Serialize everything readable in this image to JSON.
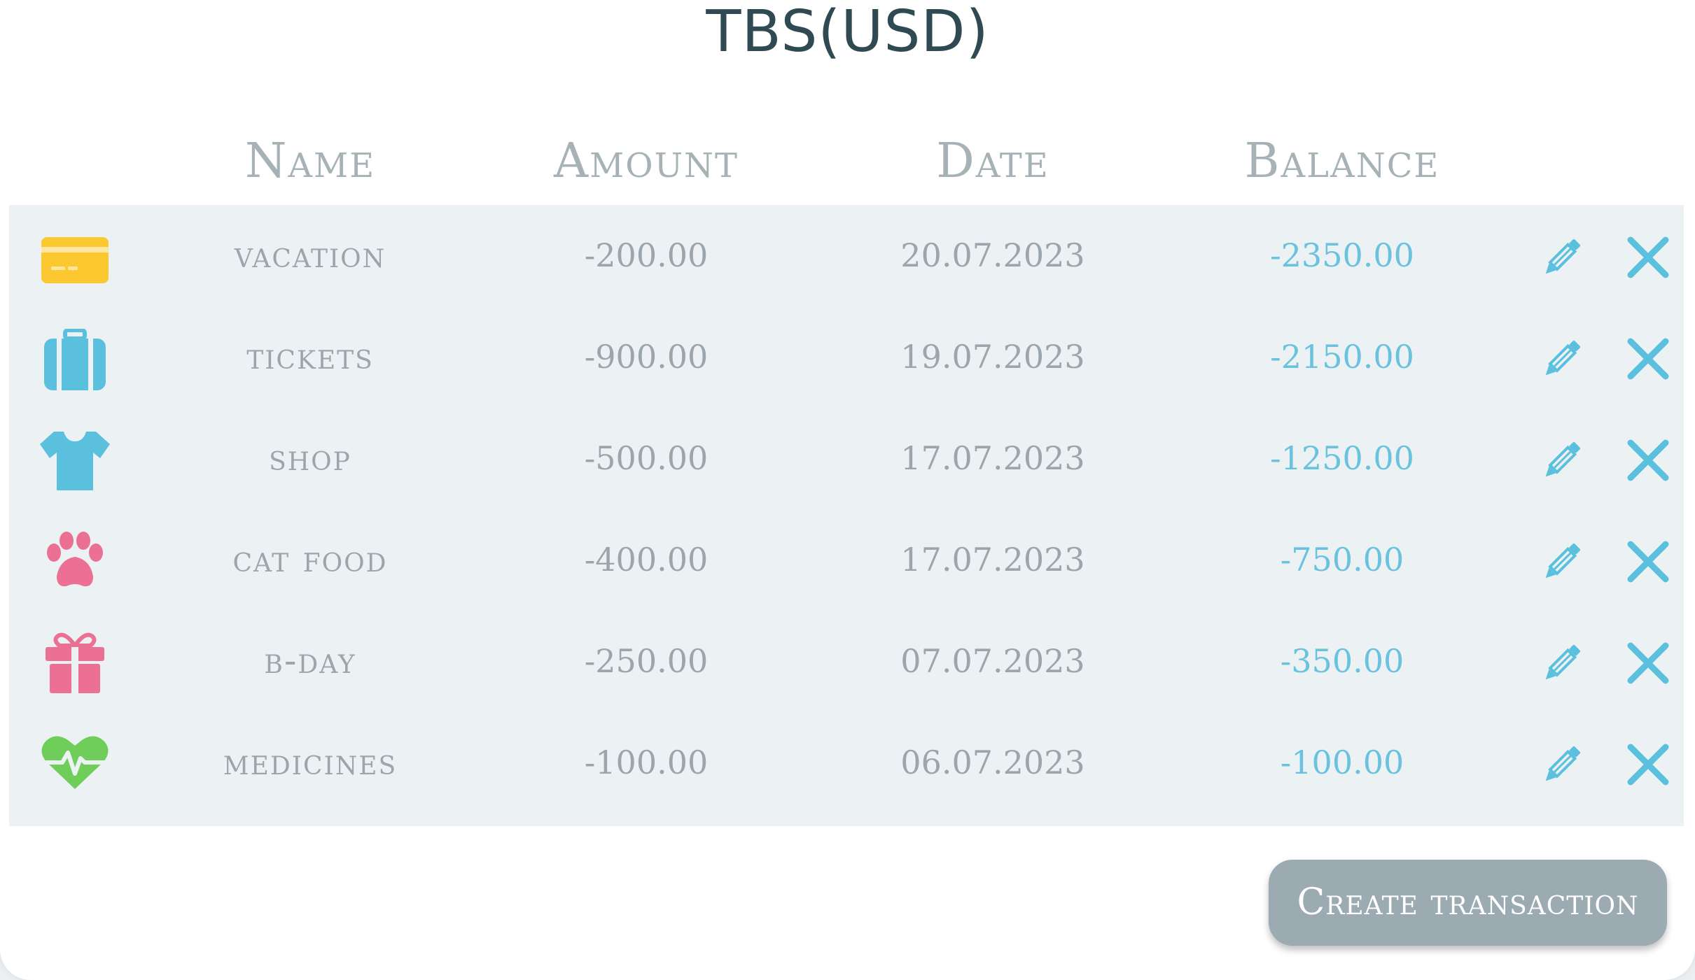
{
  "title": "TBS(USD)",
  "columns": {
    "name": "Name",
    "amount": "Amount",
    "date": "Date",
    "balance": "Balance"
  },
  "transactions": [
    {
      "icon": "credit-card-icon",
      "icon_color": "#fbc830",
      "name": "vacation",
      "amount": "-200.00",
      "date": "20.07.2023",
      "balance": "-2350.00"
    },
    {
      "icon": "suitcase-icon",
      "icon_color": "#5bc0de",
      "name": "tickets",
      "amount": "-900.00",
      "date": "19.07.2023",
      "balance": "-2150.00"
    },
    {
      "icon": "tshirt-icon",
      "icon_color": "#5bc0de",
      "name": "shop",
      "amount": "-500.00",
      "date": "17.07.2023",
      "balance": "-1250.00"
    },
    {
      "icon": "paw-icon",
      "icon_color": "#ec6f94",
      "name": "cat food",
      "amount": "-400.00",
      "date": "17.07.2023",
      "balance": "-750.00"
    },
    {
      "icon": "gift-icon",
      "icon_color": "#ec6f94",
      "name": "b-day",
      "amount": "-250.00",
      "date": "07.07.2023",
      "balance": "-350.00"
    },
    {
      "icon": "heart-pulse-icon",
      "icon_color": "#6fce5a",
      "name": "medicines",
      "amount": "-100.00",
      "date": "06.07.2023",
      "balance": "-100.00"
    }
  ],
  "colors": {
    "accent": "#5bc0de",
    "muted_text": "#9aa6ab",
    "row_background": "#ecf2f4",
    "button_background": "#9babb1"
  },
  "actions": {
    "edit_icon": "pencil-icon",
    "delete_icon": "close-icon"
  },
  "create_button": "Create transaction"
}
